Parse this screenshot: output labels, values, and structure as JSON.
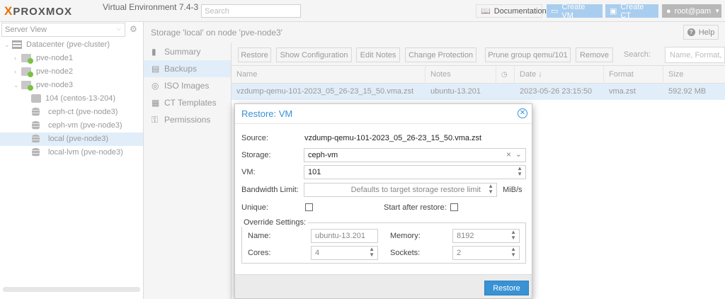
{
  "topbar": {
    "logo_x": "X",
    "logo_text": "PROXMOX",
    "version": "Virtual Environment 7.4-3",
    "search_placeholder": "Search",
    "documentation": "Documentation",
    "create_vm": "Create VM",
    "create_ct": "Create CT",
    "user": "root@pam"
  },
  "sidebar": {
    "view": "Server View",
    "tree": [
      {
        "label": "Datacenter (pve-cluster)",
        "type": "datacenter",
        "icon": "datacenter-icon"
      },
      {
        "label": "pve-node1",
        "type": "node",
        "icon": "node-icon"
      },
      {
        "label": "pve-node2",
        "type": "node",
        "icon": "node-icon"
      },
      {
        "label": "pve-node3",
        "type": "node",
        "icon": "node-icon"
      },
      {
        "label": "104 (centos-13-204)",
        "type": "vm",
        "icon": "vm-icon"
      },
      {
        "label": "ceph-ct (pve-node3)",
        "type": "storage",
        "icon": "storage-icon"
      },
      {
        "label": "ceph-vm (pve-node3)",
        "type": "storage",
        "icon": "storage-icon"
      },
      {
        "label": "local (pve-node3)",
        "type": "storage",
        "icon": "storage-icon",
        "selected": true
      },
      {
        "label": "local-lvm (pve-node3)",
        "type": "storage",
        "icon": "storage-icon"
      }
    ]
  },
  "main": {
    "title": "Storage 'local' on node 'pve-node3'",
    "help": "Help",
    "nav": [
      {
        "label": "Summary",
        "icon": "book-icon"
      },
      {
        "label": "Backups",
        "icon": "floppy-icon",
        "selected": true
      },
      {
        "label": "ISO Images",
        "icon": "disc-icon"
      },
      {
        "label": "CT Templates",
        "icon": "template-icon"
      },
      {
        "label": "Permissions",
        "icon": "unlock-icon"
      }
    ],
    "toolbar": {
      "restore": "Restore",
      "show_configuration": "Show Configuration",
      "edit_notes": "Edit Notes",
      "change_protection": "Change Protection",
      "prune_group": "Prune group qemu/101",
      "remove": "Remove",
      "search_label": "Search:",
      "search_placeholder": "Name, Format, Notes"
    },
    "grid": {
      "columns": [
        "Name",
        "Notes",
        "",
        "Date ↓",
        "Format",
        "Size"
      ],
      "rows": [
        {
          "name": "vzdump-qemu-101-2023_05_26-23_15_50.vma.zst",
          "notes": "ubuntu-13.201",
          "protected": "",
          "date": "2023-05-26 23:15:50",
          "format": "vma.zst",
          "size": "592.92 MB"
        }
      ]
    }
  },
  "dialog": {
    "title": "Restore: VM",
    "source_label": "Source:",
    "source_value": "vzdump-qemu-101-2023_05_26-23_15_50.vma.zst",
    "storage_label": "Storage:",
    "storage_value": "ceph-vm",
    "vm_label": "VM:",
    "vm_value": "101",
    "bwlimit_label": "Bandwidth Limit:",
    "bwlimit_placeholder": "Defaults to target storage restore limit",
    "bwlimit_unit": "MiB/s",
    "unique_label": "Unique:",
    "start_label": "Start after restore:",
    "override_legend": "Override Settings:",
    "name_label": "Name:",
    "name_value": "ubuntu-13.201",
    "memory_label": "Memory:",
    "memory_value": "8192",
    "cores_label": "Cores:",
    "cores_value": "4",
    "sockets_label": "Sockets:",
    "sockets_value": "2",
    "restore_button": "Restore"
  }
}
